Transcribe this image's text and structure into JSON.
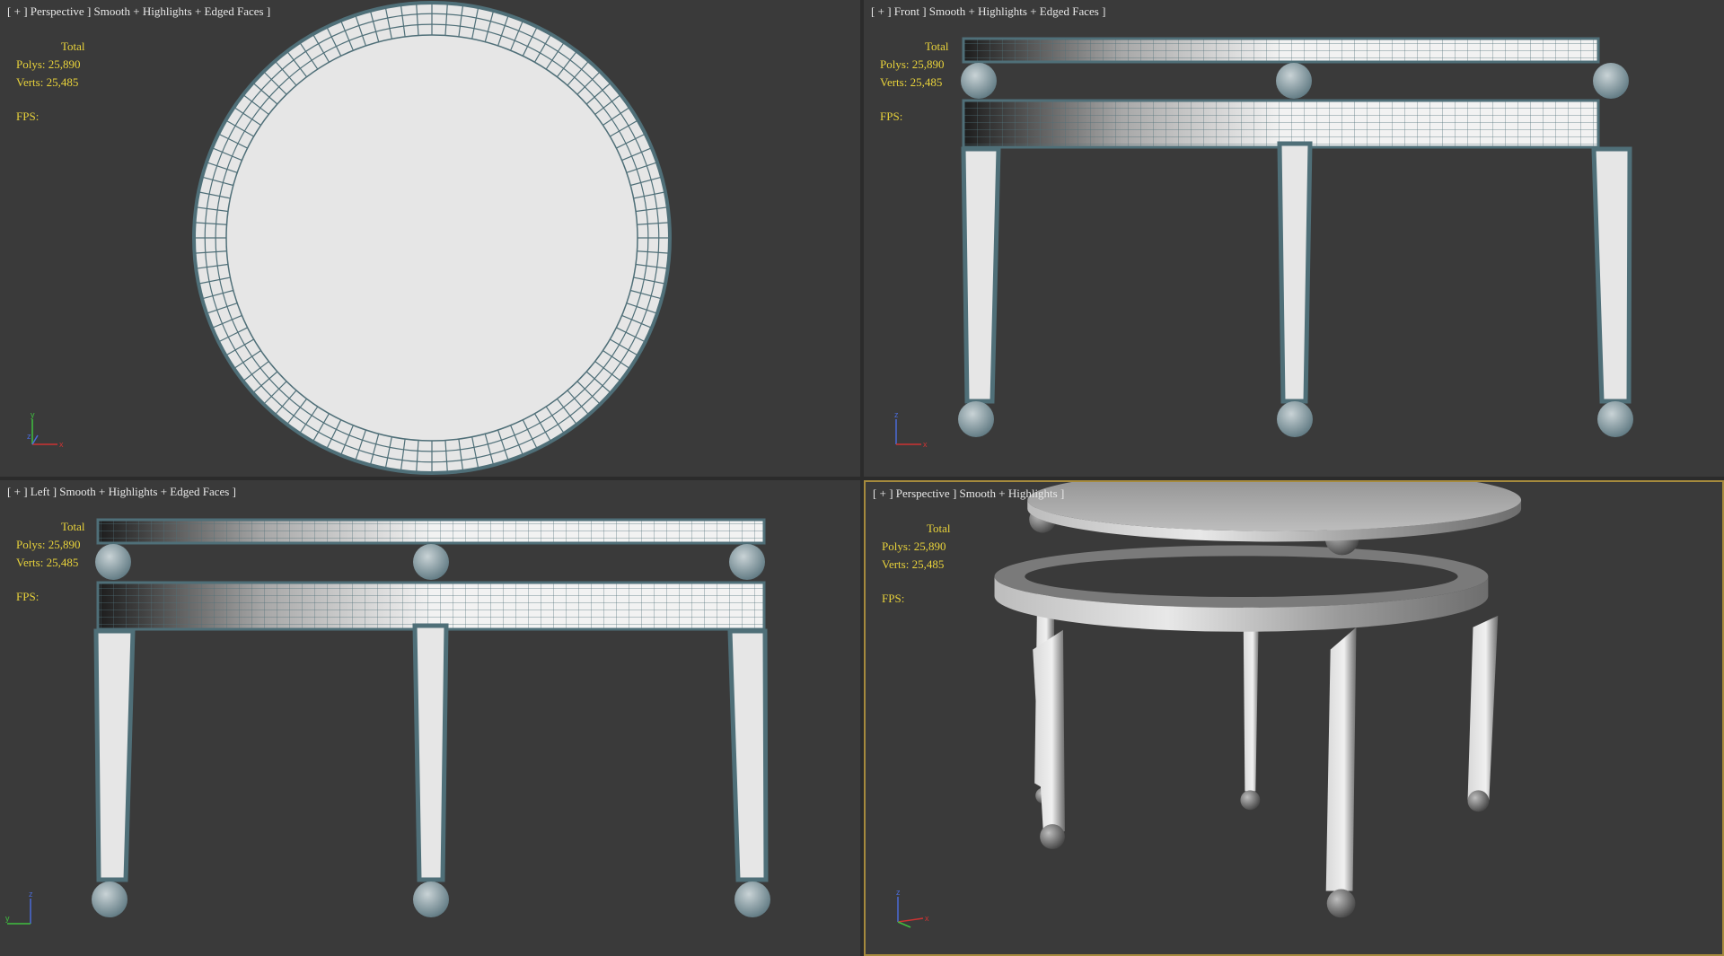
{
  "viewports": [
    {
      "id": "top-left",
      "plus": "+",
      "view": "Perspective",
      "shading": "Smooth + Highlights + Edged Faces",
      "stats": {
        "total": "Total",
        "polys": "Polys: 25,890",
        "verts": "Verts: 25,485",
        "fps": "FPS:"
      },
      "axis": {
        "y": "y",
        "x": "x",
        "z": "z"
      }
    },
    {
      "id": "top-right",
      "plus": "+",
      "view": "Front",
      "shading": "Smooth + Highlights + Edged Faces",
      "stats": {
        "total": "Total",
        "polys": "Polys: 25,890",
        "verts": "Verts: 25,485",
        "fps": "FPS:"
      },
      "axis": {
        "z": "z",
        "x": "x"
      }
    },
    {
      "id": "bottom-left",
      "plus": "+",
      "view": "Left",
      "shading": "Smooth + Highlights + Edged Faces",
      "stats": {
        "total": "Total",
        "polys": "Polys: 25,890",
        "verts": "Verts: 25,485",
        "fps": "FPS:"
      },
      "axis": {
        "z": "z",
        "y": "y"
      }
    },
    {
      "id": "bottom-right",
      "plus": "+",
      "view": "Perspective",
      "shading": "Smooth + Highlights",
      "stats": {
        "total": "Total",
        "polys": "Polys: 25,890",
        "verts": "Verts: 25,485",
        "fps": "FPS:"
      },
      "axis": {
        "z": "z",
        "x": "x"
      }
    }
  ],
  "colors": {
    "viewport_bg": "#3a3a3a",
    "active_border": "#a58a3d",
    "stats_text": "#e8d23a",
    "label_text": "#e8e8e8",
    "mesh_fill": "#e6e6e6",
    "edge_color": "#4f6f78"
  }
}
